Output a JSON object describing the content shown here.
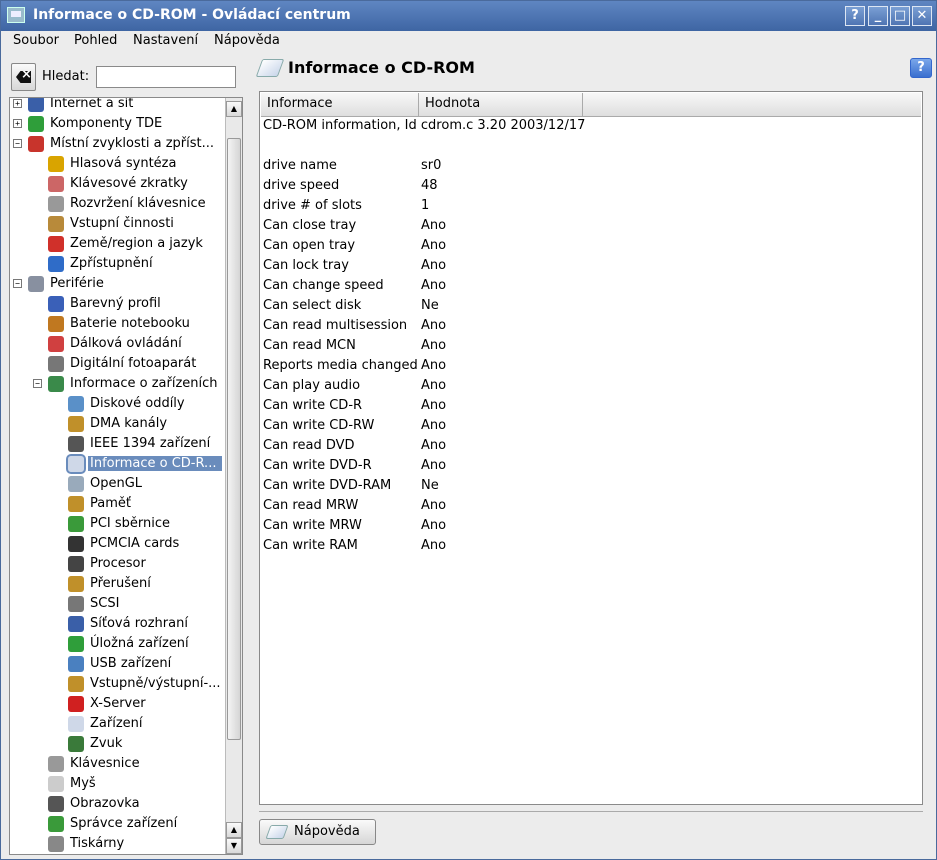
{
  "window": {
    "title": "Informace o CD-ROM - Ovládací centrum",
    "buttons": {
      "help": "?",
      "minimize": "_",
      "maximize": "□",
      "close": "✕"
    }
  },
  "menu": [
    "Soubor",
    "Pohled",
    "Nastavení",
    "Nápověda"
  ],
  "search": {
    "label": "Hledat:",
    "value": ""
  },
  "tree": [
    {
      "label": "Internet a síť",
      "level": 0,
      "expander": "+",
      "icon": "globe-icon",
      "color": "#3a5fa8"
    },
    {
      "label": "Komponenty TDE",
      "level": 0,
      "expander": "+",
      "icon": "components-icon",
      "color": "#2f9e3a"
    },
    {
      "label": "Místní zvyklosti a zpřístupnění",
      "level": 0,
      "expander": "−",
      "icon": "flag-icon",
      "color": "#c8342c"
    },
    {
      "label": "Hlasová syntéza",
      "level": 1,
      "icon": "speech-icon",
      "color": "#d9a400"
    },
    {
      "label": "Klávesové zkratky",
      "level": 1,
      "icon": "shortcuts-icon",
      "color": "#c66"
    },
    {
      "label": "Rozvržení klávesnice",
      "level": 1,
      "icon": "keyboard-icon",
      "color": "#999"
    },
    {
      "label": "Vstupní činnosti",
      "level": 1,
      "icon": "input-actions-icon",
      "color": "#b88a3a"
    },
    {
      "label": "Země/region a jazyk",
      "level": 1,
      "icon": "flag-icon",
      "color": "#d0302a"
    },
    {
      "label": "Zpřístupnění",
      "level": 1,
      "icon": "accessibility-icon",
      "color": "#2f6cc8"
    },
    {
      "label": "Periférie",
      "level": 0,
      "expander": "−",
      "icon": "peripherals-icon",
      "color": "#8890a0"
    },
    {
      "label": "Barevný profil",
      "level": 1,
      "icon": "color-profile-icon",
      "color": "#3a60b8"
    },
    {
      "label": "Baterie notebooku",
      "level": 1,
      "icon": "battery-icon",
      "color": "#c07820"
    },
    {
      "label": "Dálková ovládání",
      "level": 1,
      "icon": "remote-icon",
      "color": "#d04040"
    },
    {
      "label": "Digitální fotoaparát",
      "level": 1,
      "icon": "camera-icon",
      "color": "#777"
    },
    {
      "label": "Informace o zařízeních",
      "level": 1,
      "expander": "−",
      "icon": "device-info-icon",
      "color": "#3a8a4a"
    },
    {
      "label": "Diskové oddíly",
      "level": 2,
      "icon": "partitions-icon",
      "color": "#5a90c8"
    },
    {
      "label": "DMA kanály",
      "level": 2,
      "icon": "dma-icon",
      "color": "#c0902a"
    },
    {
      "label": "IEEE 1394 zařízení",
      "level": 2,
      "icon": "firewire-icon",
      "color": "#555"
    },
    {
      "label": "Informace o CD-ROM",
      "level": 2,
      "icon": "cdrom-icon",
      "color": "#cfd8e8",
      "selected": true
    },
    {
      "label": "OpenGL",
      "level": 2,
      "icon": "opengl-icon",
      "color": "#9ab"
    },
    {
      "label": "Paměť",
      "level": 2,
      "icon": "memory-icon",
      "color": "#c0902a"
    },
    {
      "label": "PCI sběrnice",
      "level": 2,
      "icon": "pci-icon",
      "color": "#3a9a3a"
    },
    {
      "label": "PCMCIA cards",
      "level": 2,
      "icon": "pcmcia-icon",
      "color": "#333"
    },
    {
      "label": "Procesor",
      "level": 2,
      "icon": "cpu-icon",
      "color": "#444"
    },
    {
      "label": "Přerušení",
      "level": 2,
      "icon": "interrupts-icon",
      "color": "#c0902a"
    },
    {
      "label": "SCSI",
      "level": 2,
      "icon": "scsi-icon",
      "color": "#777"
    },
    {
      "label": "Síťová rozhraní",
      "level": 2,
      "icon": "network-icon",
      "color": "#3a5fa8"
    },
    {
      "label": "Úložná zařízení",
      "level": 2,
      "icon": "storage-icon",
      "color": "#2f9e3a"
    },
    {
      "label": "USB zařízení",
      "level": 2,
      "icon": "usb-icon",
      "color": "#4a80c0"
    },
    {
      "label": "Vstupně/výstupní porty",
      "level": 2,
      "icon": "io-ports-icon",
      "color": "#c0902a"
    },
    {
      "label": "X-Server",
      "level": 2,
      "icon": "x-server-icon",
      "color": "#d02020"
    },
    {
      "label": "Zařízení",
      "level": 2,
      "icon": "devices-icon",
      "color": "#cfd8e8"
    },
    {
      "label": "Zvuk",
      "level": 2,
      "icon": "sound-icon",
      "color": "#3a7a3a"
    },
    {
      "label": "Klávesnice",
      "level": 1,
      "icon": "keyboard-icon",
      "color": "#999"
    },
    {
      "label": "Myš",
      "level": 1,
      "icon": "mouse-icon",
      "color": "#ccc"
    },
    {
      "label": "Obrazovka",
      "level": 1,
      "icon": "display-icon",
      "color": "#555"
    },
    {
      "label": "Správce zařízení",
      "level": 1,
      "icon": "device-manager-icon",
      "color": "#3a9a3a"
    },
    {
      "label": "Tiskárny",
      "level": 1,
      "icon": "printer-icon",
      "color": "#888"
    }
  ],
  "tree_display": {
    "3": "Místní zvyklosti a zpříst...",
    "19": "Informace o CD-R...",
    "30": "Vstupně/výstupní-..."
  },
  "page": {
    "title": "Informace o CD-ROM",
    "help_button": "Nápověda"
  },
  "table": {
    "columns": [
      "Informace",
      "Hodnota"
    ],
    "intro": "CD-ROM information, Id cdrom.c 3.20 2003/12/17",
    "rows": [
      [
        "drive name",
        "sr0"
      ],
      [
        "drive speed",
        "48"
      ],
      [
        "drive # of slots",
        "1"
      ],
      [
        "Can close tray",
        "Ano"
      ],
      [
        "Can open tray",
        "Ano"
      ],
      [
        "Can lock tray",
        "Ano"
      ],
      [
        "Can change speed",
        "Ano"
      ],
      [
        "Can select disk",
        "Ne"
      ],
      [
        "Can read multisession",
        "Ano"
      ],
      [
        "Can read MCN",
        "Ano"
      ],
      [
        "Reports media changed",
        "Ano"
      ],
      [
        "Can play audio",
        "Ano"
      ],
      [
        "Can write CD-R",
        "Ano"
      ],
      [
        "Can write CD-RW",
        "Ano"
      ],
      [
        "Can read DVD",
        "Ano"
      ],
      [
        "Can write DVD-R",
        "Ano"
      ],
      [
        "Can write DVD-RAM",
        "Ne"
      ],
      [
        "Can read MRW",
        "Ano"
      ],
      [
        "Can write MRW",
        "Ano"
      ],
      [
        "Can write RAM",
        "Ano"
      ]
    ]
  }
}
